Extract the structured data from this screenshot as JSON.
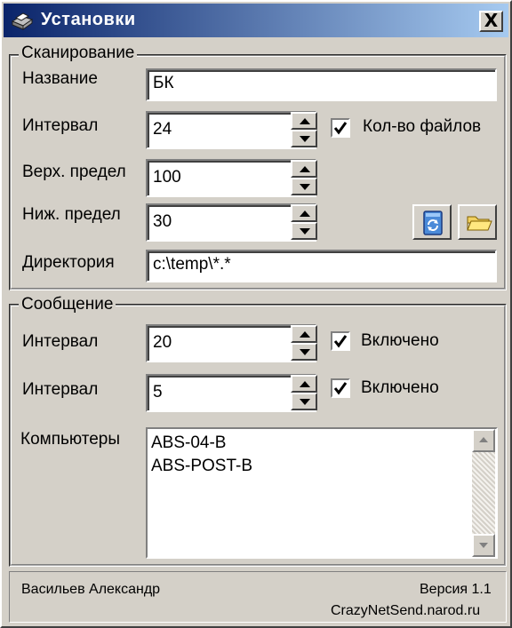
{
  "window": {
    "title": "Установки",
    "close_label": "X"
  },
  "scan": {
    "group_title": "Сканирование",
    "name_label": "Название",
    "name_value": "БК",
    "interval_label": "Интервал",
    "interval_value": "24",
    "file_count_label": "Кол-во файлов",
    "file_count_checked": true,
    "upper_label": "Верх. предел",
    "upper_value": "100",
    "lower_label": "Ниж. предел",
    "lower_value": "30",
    "dir_label": "Директория",
    "dir_value": "c:\\temp\\*.*"
  },
  "message": {
    "group_title": "Сообщение",
    "interval1_label": "Интервал",
    "interval1_value": "20",
    "enabled1_label": "Включено",
    "enabled1_checked": true,
    "interval2_label": "Интервал",
    "interval2_value": "5",
    "enabled2_label": "Включено",
    "enabled2_checked": true,
    "computers_label": "Компьютеры",
    "computers": [
      "ABS-04-B",
      "ABS-POST-B"
    ]
  },
  "status": {
    "author": "Васильев Александр",
    "version": "Версия 1.1",
    "site": "CrazyNetSend.narod.ru"
  },
  "icons": {
    "title": "printer-icon",
    "refresh": "refresh-icon",
    "folder": "folder-open-icon"
  }
}
